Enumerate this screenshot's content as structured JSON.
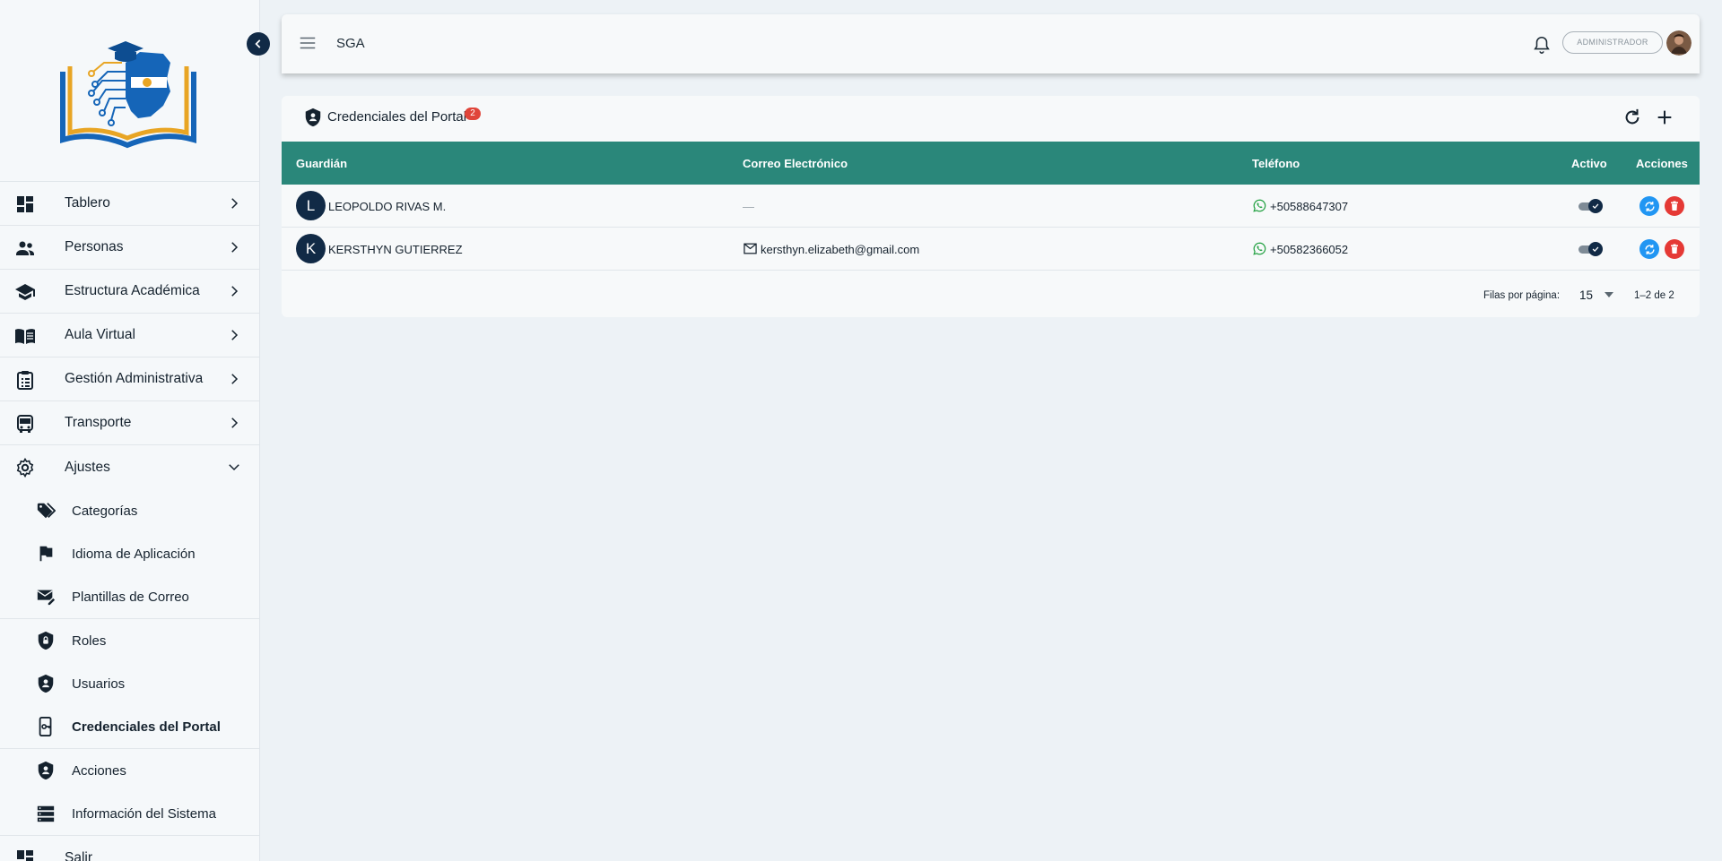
{
  "sidebar": {
    "items": [
      {
        "label": "Tablero",
        "icon": "dashboard-icon"
      },
      {
        "label": "Personas",
        "icon": "people-icon"
      },
      {
        "label": "Estructura Académica",
        "icon": "school-icon"
      },
      {
        "label": "Aula Virtual",
        "icon": "book-icon"
      },
      {
        "label": "Gestión Administrativa",
        "icon": "clipboard-icon"
      },
      {
        "label": "Transporte",
        "icon": "bus-icon"
      },
      {
        "label": "Ajustes",
        "icon": "gear-icon",
        "expanded": true
      }
    ],
    "subitems": [
      {
        "label": "Categorías",
        "icon": "tag-icon"
      },
      {
        "label": "Idioma de Aplicación",
        "icon": "flag-icon"
      },
      {
        "label": "Plantillas de Correo",
        "icon": "mail-edit-icon"
      },
      {
        "label": "Roles",
        "icon": "shield-lock-icon"
      },
      {
        "label": "Usuarios",
        "icon": "shield-user-icon"
      },
      {
        "label": "Credenciales del Portal",
        "icon": "phone-key-icon",
        "active": true
      },
      {
        "label": "Acciones",
        "icon": "shield-user-icon"
      },
      {
        "label": "Información del Sistema",
        "icon": "server-icon"
      }
    ],
    "logout_label": "Salir"
  },
  "topbar": {
    "title": "SGA",
    "role": "ADMINISTRADOR"
  },
  "card": {
    "title": "Credenciales del Portal",
    "count": "2",
    "columns": {
      "guardian": "Guardián",
      "email": "Correo Electrónico",
      "phone": "Teléfono",
      "active": "Activo",
      "actions": "Acciones"
    },
    "rows": [
      {
        "initial": "L",
        "name": "LEOPOLDO RIVAS M.",
        "email": "—",
        "phone": "+50588647307",
        "active": true
      },
      {
        "initial": "K",
        "name": "KERSTHYN GUTIERREZ",
        "email": "kersthyn.elizabeth@gmail.com",
        "phone": "+50582366052",
        "active": true
      }
    ],
    "pagination": {
      "rows_per_page_label": "Filas por página:",
      "rows_per_page": "15",
      "range": "1–2 de 2"
    }
  },
  "colors": {
    "header_teal": "#2a877a",
    "navy": "#112a46",
    "badge_red": "#e0453a",
    "sync_blue": "#2196f3",
    "delete_red": "#e53935",
    "whatsapp_green": "#25a244"
  }
}
